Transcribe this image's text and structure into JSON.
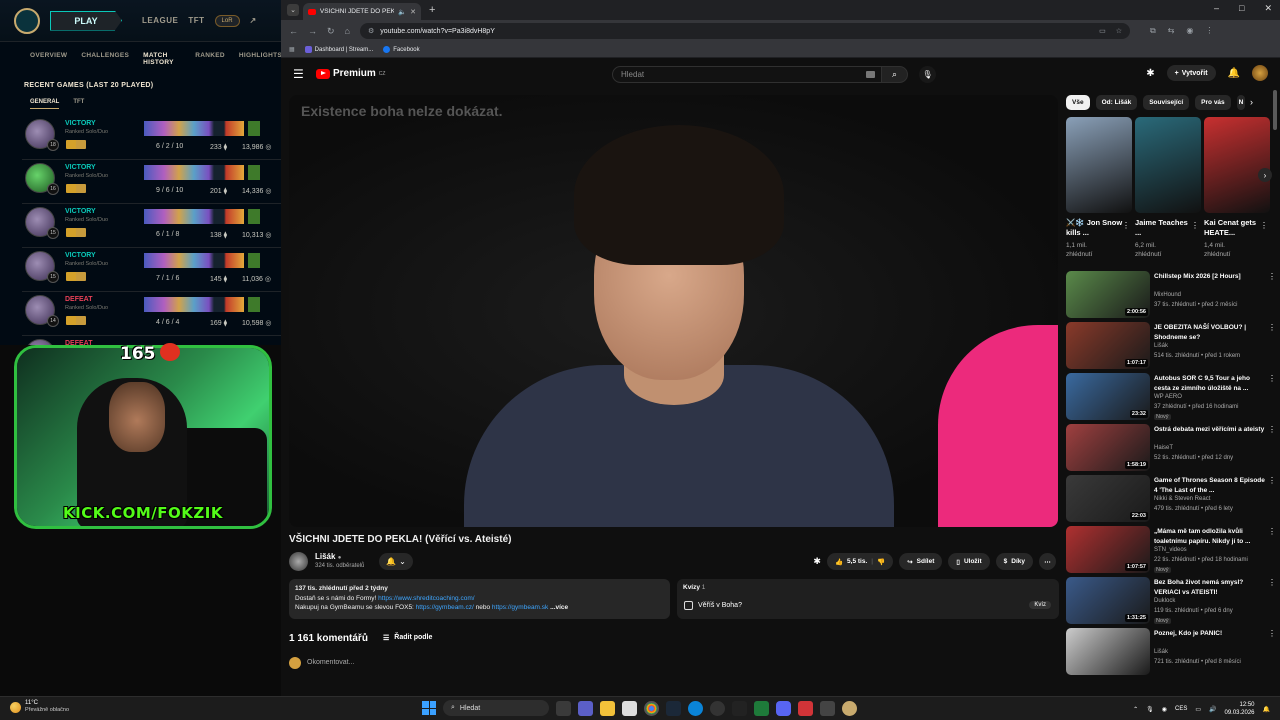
{
  "lol": {
    "play_label": "PLAY",
    "nav": [
      "LEAGUE",
      "TFT"
    ],
    "lor_label": "LoR",
    "subnav": [
      "OVERVIEW",
      "CHALLENGES",
      "MATCH HISTORY",
      "RANKED",
      "HIGHLIGHTS"
    ],
    "recent_title": "RECENT GAMES (LAST 20 PLAYED)",
    "game_tabs": [
      "GENERAL",
      "TFT"
    ],
    "games": [
      {
        "result": "VICTORY",
        "mode": "Ranked Solo/Duo",
        "level": "18",
        "kda": "6 / 2 / 10",
        "cs": "233",
        "gold": "13,986"
      },
      {
        "result": "VICTORY",
        "mode": "Ranked Solo/Duo",
        "level": "16",
        "kda": "9 / 6 / 10",
        "cs": "201",
        "gold": "14,336"
      },
      {
        "result": "VICTORY",
        "mode": "Ranked Solo/Duo",
        "level": "15",
        "kda": "6 / 1 / 8",
        "cs": "138",
        "gold": "10,313"
      },
      {
        "result": "VICTORY",
        "mode": "Ranked Solo/Duo",
        "level": "15",
        "kda": "7 / 1 / 6",
        "cs": "145",
        "gold": "11,036"
      },
      {
        "result": "DEFEAT",
        "mode": "Ranked Solo/Duo",
        "level": "14",
        "kda": "4 / 6 / 4",
        "cs": "169",
        "gold": "10,598"
      },
      {
        "result": "DEFEAT",
        "mode": "",
        "level": "",
        "kda": "",
        "cs": "",
        "gold": ""
      }
    ]
  },
  "cam": {
    "count": "165",
    "kick_text": "KICK.COM/FOKZIK"
  },
  "browser": {
    "tab_title": "VŠICHNI JDETE DO PEKLA!",
    "url": "youtube.com/watch?v=Pa3i8dvH8pY",
    "bookmarks": [
      "Dashboard | Stream...",
      "Facebook"
    ]
  },
  "youtube": {
    "logo": "Premium",
    "logo_region": "CZ",
    "search_placeholder": "Hledat",
    "create_label": "Vytvořit",
    "video_overlay_text": "Existence boha nelze dokázat.",
    "video_title": "VŠICHNI JDETE DO PEKLA! (Věřící vs. Ateisté)",
    "channel": "Lišák",
    "subscribers": "324 tis. odběratelů",
    "actions": {
      "likes": "5,5 tis.",
      "share": "Sdílet",
      "save": "Uložit",
      "thanks": "Díky"
    },
    "description": {
      "stats": "137 tis. zhlédnutí  před 2 týdny",
      "line1_text": "Dostaň se s námi do Formy! ",
      "line1_link": "https://www.shreditcoaching.com/",
      "line2_text": "Nakupuj na GymBeamu se slevou FOX5: ",
      "line2_link1": "https://gymbeam.cz/",
      "line2_mid": " nebo ",
      "line2_link2": "https://gymbeam.sk",
      "more": "...více"
    },
    "quiz": {
      "label": "Kvízy",
      "count": "1",
      "question": "Věříš v Boha?",
      "tag": "Kvíz"
    },
    "comments_count": "1 161 komentářů",
    "sort_label": "Řadit podle",
    "comment_placeholder": "Okomentovat...",
    "chips": [
      "Vše",
      "Od: Lišák",
      "Související",
      "Pro vás",
      "N"
    ],
    "shorts": [
      {
        "title": "⚔️❄️ Jon Snow kills ...",
        "views": "1,1 mil.",
        "views2": "zhlédnutí",
        "color": "#8aa0b8"
      },
      {
        "title": "Jaime Teaches ...",
        "views": "6,2 mil.",
        "views2": "zhlédnutí",
        "color": "#2a6a7a"
      },
      {
        "title": "Kai Cenat gets HEATE...",
        "views": "1,4 mil.",
        "views2": "zhlédnutí",
        "color": "#c83030"
      }
    ],
    "recommendations": [
      {
        "title": "Chillstep Mix 2026 [2 Hours]",
        "channel": "MixHound",
        "meta": "37 tis. zhlédnutí • před 2 měsíci",
        "duration": "2:00:56",
        "badge": "",
        "color": "#5a8a4a"
      },
      {
        "title": "JE OBEZITA NAŠÍ VOLBOU? | Shodneme se?",
        "channel": "Lišák",
        "meta": "514 tis. zhlédnutí • před 1 rokem",
        "duration": "1:07:17",
        "badge": "",
        "color": "#8a3a2a"
      },
      {
        "title": "Autobus SOR C 9,5 Tour a jeho cesta ze zimního úložiště na ...",
        "channel": "WP AERO",
        "meta": "37 zhlédnutí • před 16 hodinami",
        "duration": "23:32",
        "badge": "Nový",
        "color": "#3a6aa0"
      },
      {
        "title": "Ostrá debata mezi věřícími a ateisty",
        "channel": "HaiseT",
        "meta": "52 tis. zhlédnutí • před 12 dny",
        "duration": "1:58:19",
        "badge": "",
        "color": "#a04040"
      },
      {
        "title": "Game of Thrones Season 8 Episode 4 'The Last of the ...",
        "channel": "Nikki & Steven React",
        "meta": "479 tis. zhlédnutí • před 6 lety",
        "duration": "22:03",
        "badge": "",
        "color": "#3a3a3a"
      },
      {
        "title": "„Máma mě tam odložila kvůli toaletnímu papíru. Nikdy jí to ...",
        "channel": "STN_videos",
        "meta": "22 tis. zhlédnutí • před 18 hodinami",
        "duration": "1:07:57",
        "badge": "Nový",
        "color": "#b03030"
      },
      {
        "title": "Bez Boha život nemá smysl? VERIACI vs ATEISTI!",
        "channel": "Duklock",
        "meta": "119 tis. zhlédnutí • před 6 dny",
        "duration": "1:31:25",
        "badge": "Nový",
        "color": "#3a5a8a"
      },
      {
        "title": "Poznej, Kdo je PANIC!",
        "channel": "Lišák",
        "meta": "721 tis. zhlédnutí • před 8 měsíci",
        "duration": "",
        "badge": "",
        "color": "#cccccc"
      }
    ]
  },
  "taskbar": {
    "temp": "11°C",
    "weather": "Převážně oblačno",
    "search": "Hledat",
    "lang": "CES",
    "time": "12:50",
    "date": "09.03.2026"
  }
}
